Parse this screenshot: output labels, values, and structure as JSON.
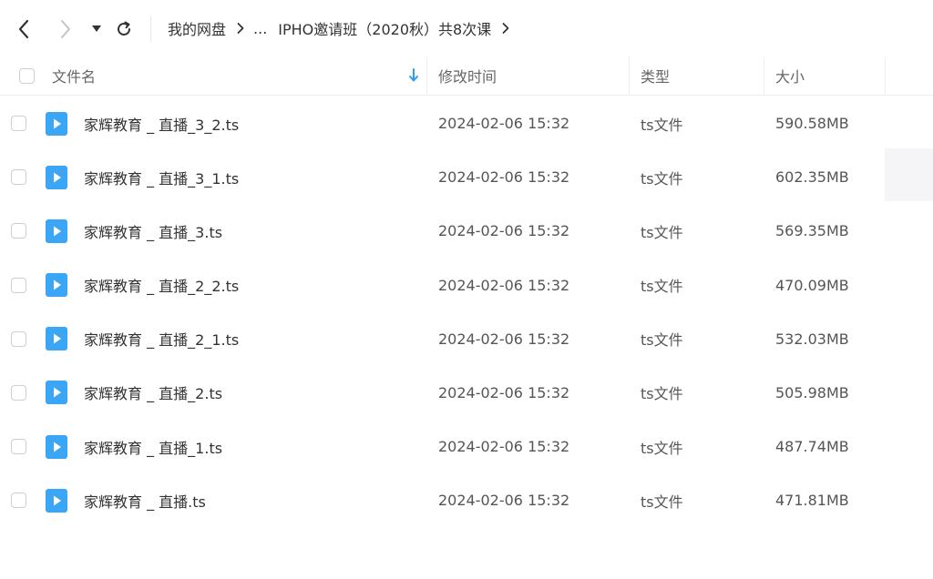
{
  "toolbar": {
    "back_icon": "chevron-left-icon",
    "forward_icon": "chevron-right-icon",
    "history_icon": "caret-down-icon",
    "refresh_icon": "refresh-icon"
  },
  "breadcrumb": {
    "root": "我的网盘",
    "ellipsis": "...",
    "current": "IPHO邀请班（2020秋）共8次课"
  },
  "table": {
    "columns": {
      "name": "文件名",
      "modified": "修改时间",
      "type": "类型",
      "size": "大小"
    },
    "sort_icon": "sort-down-arrow-icon",
    "rows": [
      {
        "name": "家辉教育 _ 直播_3_2.ts",
        "modified": "2024-02-06 15:32",
        "type": "ts文件",
        "size": "590.58MB",
        "icon": "video-file-icon"
      },
      {
        "name": "家辉教育 _ 直播_3_1.ts",
        "modified": "2024-02-06 15:32",
        "type": "ts文件",
        "size": "602.35MB",
        "icon": "video-file-icon"
      },
      {
        "name": "家辉教育 _ 直播_3.ts",
        "modified": "2024-02-06 15:32",
        "type": "ts文件",
        "size": "569.35MB",
        "icon": "video-file-icon"
      },
      {
        "name": "家辉教育 _ 直播_2_2.ts",
        "modified": "2024-02-06 15:32",
        "type": "ts文件",
        "size": "470.09MB",
        "icon": "video-file-icon"
      },
      {
        "name": "家辉教育 _ 直播_2_1.ts",
        "modified": "2024-02-06 15:32",
        "type": "ts文件",
        "size": "532.03MB",
        "icon": "video-file-icon"
      },
      {
        "name": "家辉教育 _ 直播_2.ts",
        "modified": "2024-02-06 15:32",
        "type": "ts文件",
        "size": "505.98MB",
        "icon": "video-file-icon"
      },
      {
        "name": "家辉教育 _ 直播_1.ts",
        "modified": "2024-02-06 15:32",
        "type": "ts文件",
        "size": "487.74MB",
        "icon": "video-file-icon"
      },
      {
        "name": "家辉教育 _ 直播.ts",
        "modified": "2024-02-06 15:32",
        "type": "ts文件",
        "size": "471.81MB",
        "icon": "video-file-icon"
      }
    ]
  },
  "colors": {
    "accent": "#2f9cf3",
    "file_icon": "#3aa6f5",
    "text": "#333333",
    "muted": "#666666",
    "divider": "#eeeeee"
  }
}
